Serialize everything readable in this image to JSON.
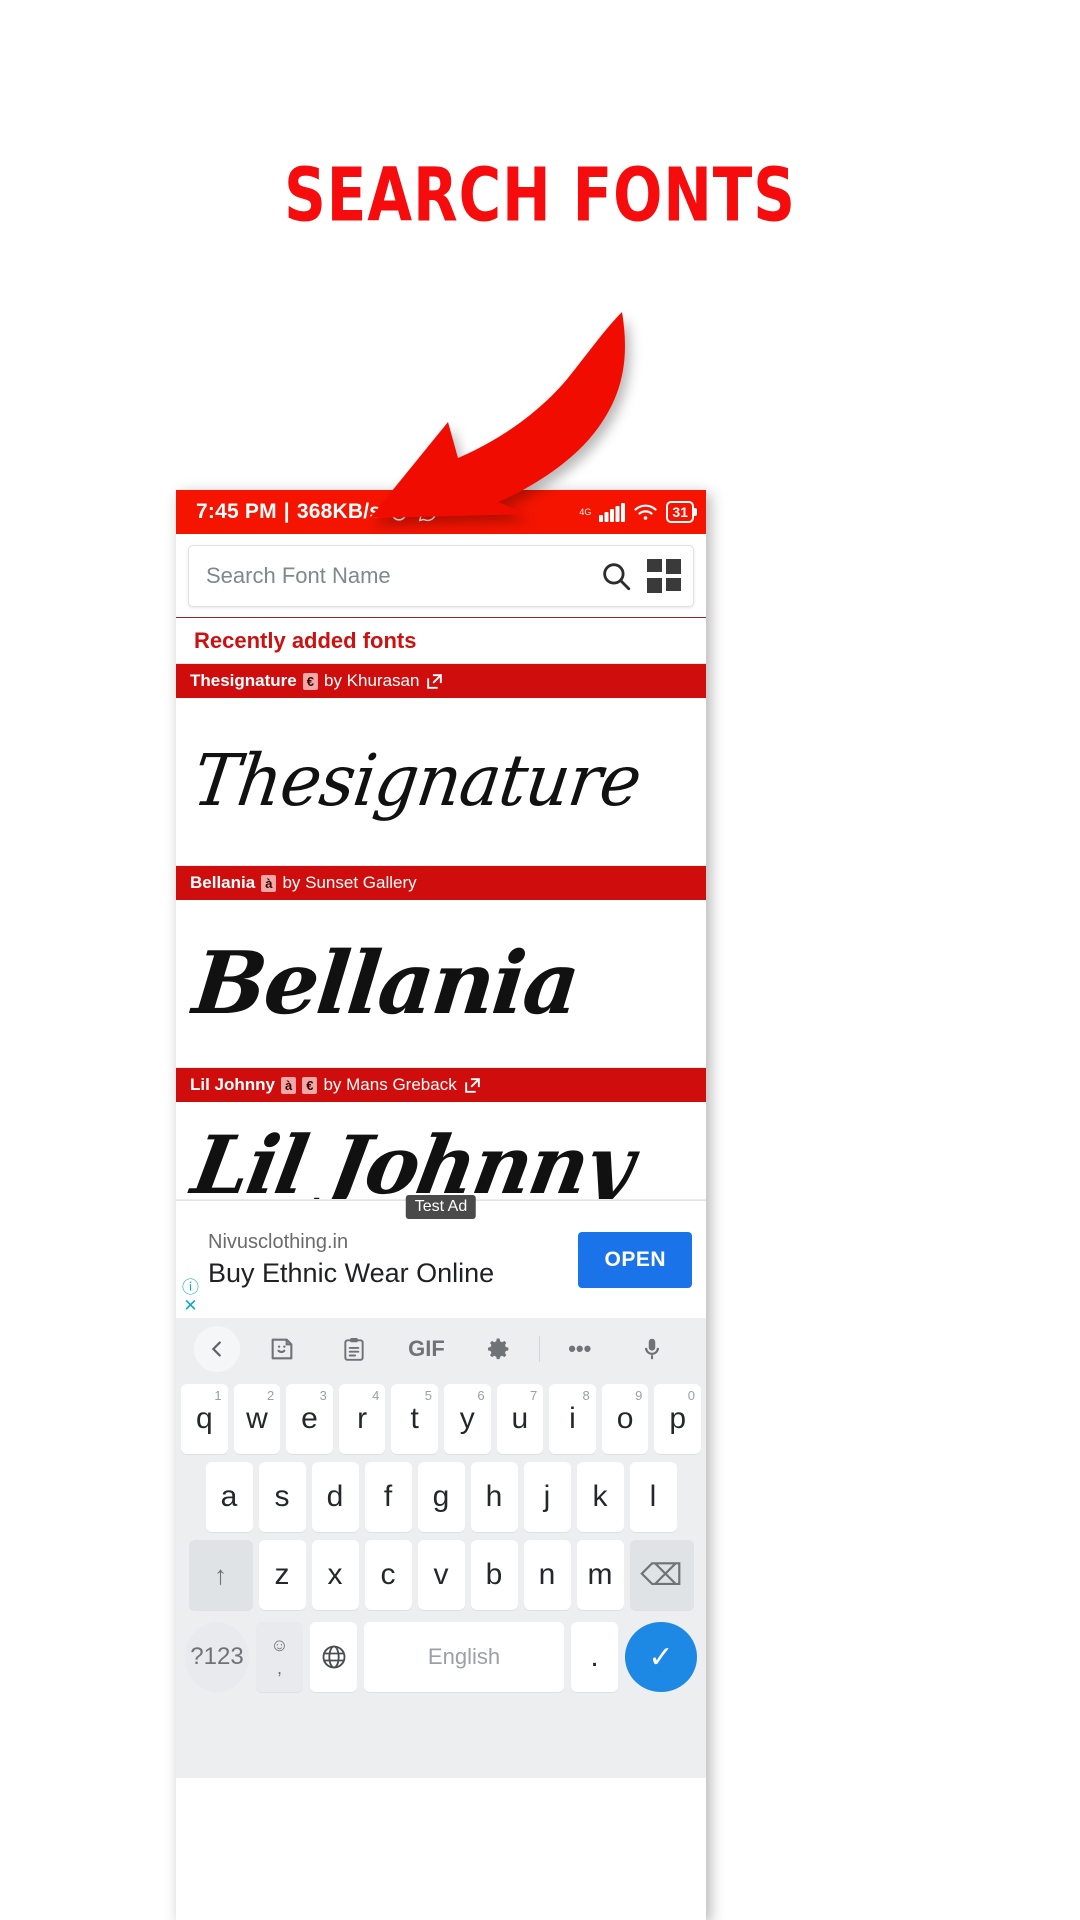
{
  "promo": {
    "headline": "SEARCH FONTS"
  },
  "status_bar": {
    "time": "7:45 PM",
    "separator": "|",
    "net_speed": "368KB/s",
    "alarm_icon": "alarm-clock-icon",
    "whatsapp_icon": "whatsapp-icon",
    "network_label": "4G",
    "signal_icon": "signal-bars-icon",
    "wifi_icon": "wifi-icon",
    "battery_level": "31"
  },
  "search": {
    "placeholder": "Search Font Name",
    "search_icon": "search-icon",
    "grid_icon": "grid-view-icon"
  },
  "section": {
    "recent_label": "Recently added fonts"
  },
  "fonts": [
    {
      "name": "Thesignature",
      "tags": [
        "€"
      ],
      "by": "by Khurasan",
      "has_link": true,
      "preview": "Thesignature"
    },
    {
      "name": "Bellania",
      "tags": [
        "à"
      ],
      "by": "by Sunset Gallery",
      "has_link": false,
      "preview": "Bellania"
    },
    {
      "name": "Lil Johnny",
      "tags": [
        "à",
        "€"
      ],
      "by": "by Mans Greback",
      "has_link": true,
      "preview": "Lil Johnny"
    }
  ],
  "ad": {
    "badge": "Test Ad",
    "url": "Nivusclothing.in",
    "headline": "Buy Ethnic Wear Online",
    "cta": "OPEN",
    "info_icon": "info-icon",
    "close_icon": "close-icon"
  },
  "keyboard": {
    "toolbar": [
      {
        "name": "back-chevron-icon",
        "glyph": "‹"
      },
      {
        "name": "sticker-icon",
        "glyph": ""
      },
      {
        "name": "clipboard-icon",
        "glyph": ""
      },
      {
        "name": "gif-icon",
        "glyph": "GIF"
      },
      {
        "name": "gear-icon",
        "glyph": ""
      },
      {
        "name": "more-options-icon",
        "glyph": "•••"
      },
      {
        "name": "microphone-icon",
        "glyph": ""
      }
    ],
    "row1": [
      {
        "letter": "q",
        "num": "1"
      },
      {
        "letter": "w",
        "num": "2"
      },
      {
        "letter": "e",
        "num": "3"
      },
      {
        "letter": "r",
        "num": "4"
      },
      {
        "letter": "t",
        "num": "5"
      },
      {
        "letter": "y",
        "num": "6"
      },
      {
        "letter": "u",
        "num": "7"
      },
      {
        "letter": "i",
        "num": "8"
      },
      {
        "letter": "o",
        "num": "9"
      },
      {
        "letter": "p",
        "num": "0"
      }
    ],
    "row2": [
      "a",
      "s",
      "d",
      "f",
      "g",
      "h",
      "j",
      "k",
      "l"
    ],
    "row3": [
      "z",
      "x",
      "c",
      "v",
      "b",
      "n",
      "m"
    ],
    "shift_label": "↑",
    "backspace_label": "⌫",
    "symbols_label": "?123",
    "emoji_label": "☺",
    "comma_label": ",",
    "globe_label": "⊕",
    "space_label": "English",
    "period_label": ".",
    "enter_label": "✓"
  },
  "colors": {
    "brand_red": "#f51400",
    "header_red": "#cf0d0d",
    "accent_blue": "#1a73e8",
    "enter_blue": "#1e88e5",
    "promo_red": "#f60c0c",
    "ad_teal": "#11a8c4"
  }
}
